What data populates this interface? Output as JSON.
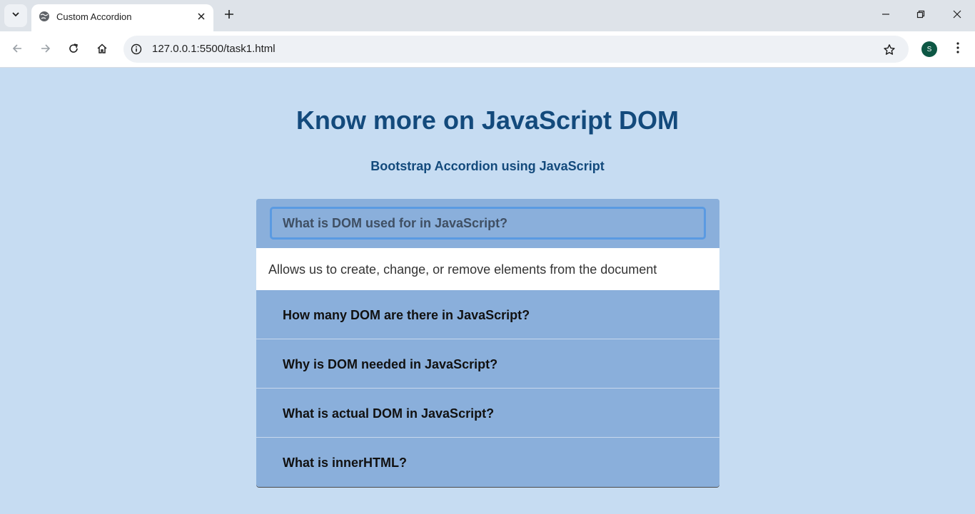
{
  "browser": {
    "tab_title": "Custom Accordion",
    "url": "127.0.0.1:5500/task1.html",
    "profile_initial": "S"
  },
  "page": {
    "title": "Know more on JavaScript DOM",
    "subtitle": "Bootstrap Accordion using JavaScript"
  },
  "accordion": {
    "items": [
      {
        "question": "What is DOM used for in JavaScript?",
        "answer": "Allows us to create, change, or remove elements from the document",
        "expanded": true
      },
      {
        "question": "How many DOM are there in JavaScript?",
        "expanded": false
      },
      {
        "question": "Why is DOM needed in JavaScript?",
        "expanded": false
      },
      {
        "question": "What is actual DOM in JavaScript?",
        "expanded": false
      },
      {
        "question": "What is innerHTML?",
        "expanded": false
      }
    ]
  },
  "colors": {
    "page_bg": "#c6dcf2",
    "heading": "#134a7c",
    "accordion_header": "#8aafdb",
    "focus_ring": "#5a9ae2"
  }
}
